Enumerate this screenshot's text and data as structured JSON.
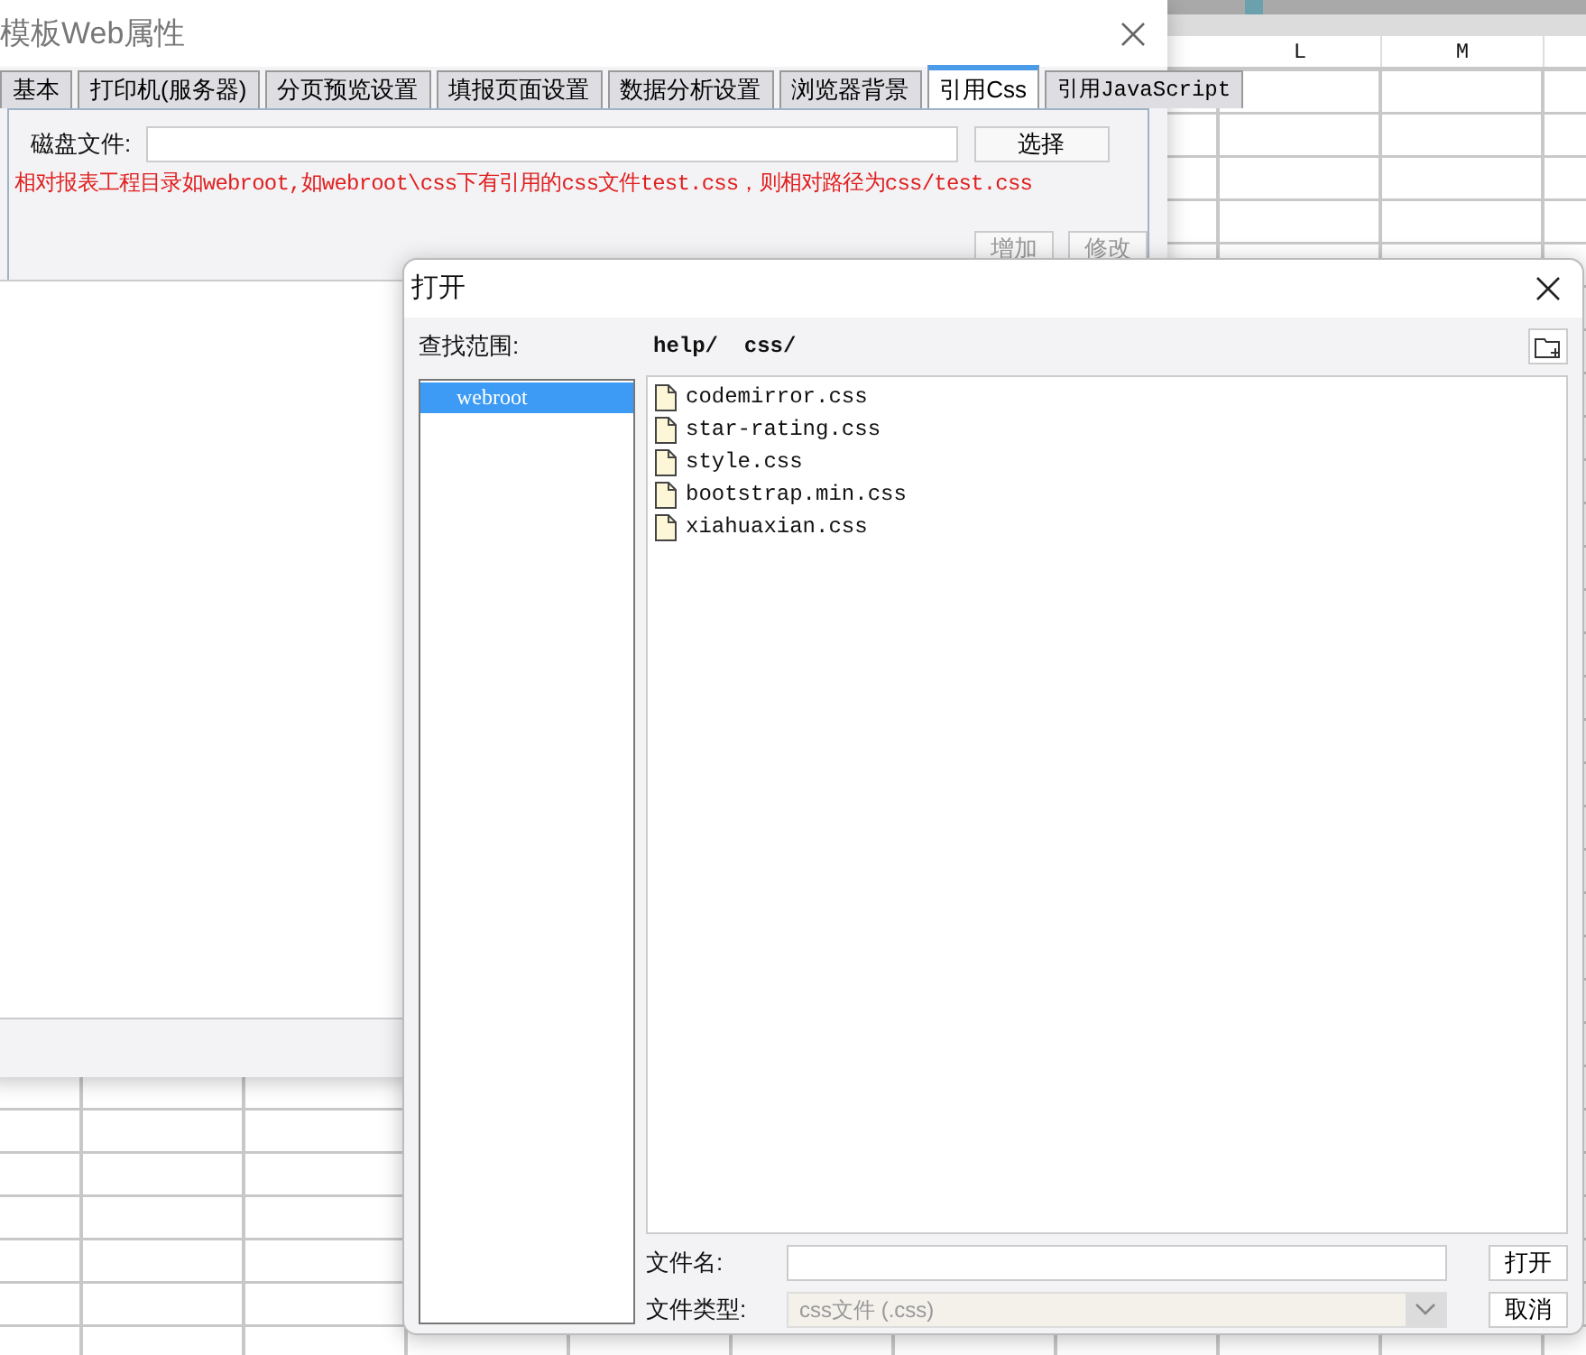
{
  "background_sheet": {
    "columns": [
      "L",
      "M"
    ]
  },
  "properties_window": {
    "title": "模板Web属性",
    "tabs": [
      {
        "label": "基本",
        "selected": false
      },
      {
        "label": "打印机(服务器)",
        "selected": false
      },
      {
        "label": "分页预览设置",
        "selected": false
      },
      {
        "label": "填报页面设置",
        "selected": false
      },
      {
        "label": "数据分析设置",
        "selected": false
      },
      {
        "label": "浏览器背景",
        "selected": false
      },
      {
        "label": "引用Css",
        "selected": true
      },
      {
        "label": "引用JavaScript",
        "selected": false
      }
    ],
    "disk_file_label": "磁盘文件:",
    "choose_button": "选择",
    "hint": "相对报表工程目录如webroot,如webroot\\css下有引用的css文件test.css，则相对路径为css/test.css",
    "buttons": [
      "增加",
      "修改"
    ]
  },
  "open_dialog": {
    "title": "打开",
    "look_in_label": "查找范围:",
    "path": "help/  css/",
    "folders": [
      {
        "name": "webroot",
        "selected": true
      }
    ],
    "files": [
      {
        "name": "codemirror.css"
      },
      {
        "name": "star-rating.css"
      },
      {
        "name": "style.css"
      },
      {
        "name": "bootstrap.min.css"
      },
      {
        "name": "xiahuaxian.css"
      }
    ],
    "file_name_label": "文件名:",
    "file_type_label": "文件类型:",
    "file_type": {
      "value": "css文件 (.css)",
      "disabled": true
    },
    "buttons": [
      "打开",
      "取消"
    ]
  }
}
